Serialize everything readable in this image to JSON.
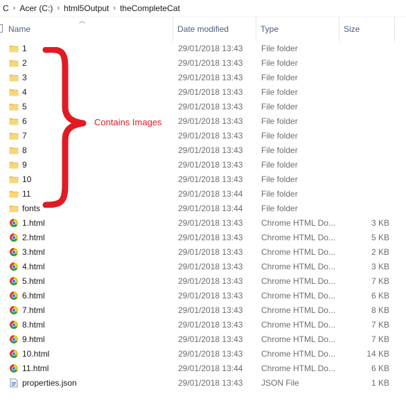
{
  "breadcrumb": {
    "items": [
      "C",
      "Acer (C:)",
      "html5Output",
      "theCompleteCat"
    ],
    "separator": "›"
  },
  "columns": {
    "name": "Name",
    "date": "Date modified",
    "type": "Type",
    "size": "Size"
  },
  "files": [
    {
      "name": "1",
      "date": "29/01/2018 13:43",
      "type": "File folder",
      "size": "",
      "icon": "folder-icon"
    },
    {
      "name": "2",
      "date": "29/01/2018 13:43",
      "type": "File folder",
      "size": "",
      "icon": "folder-icon"
    },
    {
      "name": "3",
      "date": "29/01/2018 13:43",
      "type": "File folder",
      "size": "",
      "icon": "folder-icon"
    },
    {
      "name": "4",
      "date": "29/01/2018 13:43",
      "type": "File folder",
      "size": "",
      "icon": "folder-icon"
    },
    {
      "name": "5",
      "date": "29/01/2018 13:43",
      "type": "File folder",
      "size": "",
      "icon": "folder-icon"
    },
    {
      "name": "6",
      "date": "29/01/2018 13:43",
      "type": "File folder",
      "size": "",
      "icon": "folder-icon"
    },
    {
      "name": "7",
      "date": "29/01/2018 13:43",
      "type": "File folder",
      "size": "",
      "icon": "folder-icon"
    },
    {
      "name": "8",
      "date": "29/01/2018 13:43",
      "type": "File folder",
      "size": "",
      "icon": "folder-icon"
    },
    {
      "name": "9",
      "date": "29/01/2018 13:43",
      "type": "File folder",
      "size": "",
      "icon": "folder-icon"
    },
    {
      "name": "10",
      "date": "29/01/2018 13:43",
      "type": "File folder",
      "size": "",
      "icon": "folder-icon"
    },
    {
      "name": "11",
      "date": "29/01/2018 13:44",
      "type": "File folder",
      "size": "",
      "icon": "folder-icon"
    },
    {
      "name": "fonts",
      "date": "29/01/2018 13:44",
      "type": "File folder",
      "size": "",
      "icon": "folder-icon"
    },
    {
      "name": "1.html",
      "date": "29/01/2018 13:43",
      "type": "Chrome HTML Do...",
      "size": "3 KB",
      "icon": "chrome-icon"
    },
    {
      "name": "2.html",
      "date": "29/01/2018 13:43",
      "type": "Chrome HTML Do...",
      "size": "5 KB",
      "icon": "chrome-icon"
    },
    {
      "name": "3.html",
      "date": "29/01/2018 13:43",
      "type": "Chrome HTML Do...",
      "size": "2 KB",
      "icon": "chrome-icon"
    },
    {
      "name": "4.html",
      "date": "29/01/2018 13:43",
      "type": "Chrome HTML Do...",
      "size": "3 KB",
      "icon": "chrome-icon"
    },
    {
      "name": "5.html",
      "date": "29/01/2018 13:43",
      "type": "Chrome HTML Do...",
      "size": "7 KB",
      "icon": "chrome-icon"
    },
    {
      "name": "6.html",
      "date": "29/01/2018 13:43",
      "type": "Chrome HTML Do...",
      "size": "6 KB",
      "icon": "chrome-icon"
    },
    {
      "name": "7.html",
      "date": "29/01/2018 13:43",
      "type": "Chrome HTML Do...",
      "size": "8 KB",
      "icon": "chrome-icon"
    },
    {
      "name": "8.html",
      "date": "29/01/2018 13:43",
      "type": "Chrome HTML Do...",
      "size": "7 KB",
      "icon": "chrome-icon"
    },
    {
      "name": "9.html",
      "date": "29/01/2018 13:43",
      "type": "Chrome HTML Do...",
      "size": "7 KB",
      "icon": "chrome-icon"
    },
    {
      "name": "10.html",
      "date": "29/01/2018 13:43",
      "type": "Chrome HTML Do...",
      "size": "14 KB",
      "icon": "chrome-icon"
    },
    {
      "name": "11.html",
      "date": "29/01/2018 13:44",
      "type": "Chrome HTML Do...",
      "size": "6 KB",
      "icon": "chrome-icon"
    },
    {
      "name": "properties.json",
      "date": "29/01/2018 13:43",
      "type": "JSON File",
      "size": "1 KB",
      "icon": "json-file-icon"
    }
  ],
  "annotation": {
    "label": "Contains Images",
    "color": "#e01b24"
  },
  "colors": {
    "header_text": "#4c607a",
    "folder": "#f4c95d",
    "secondary_text": "#6d6d6d"
  }
}
